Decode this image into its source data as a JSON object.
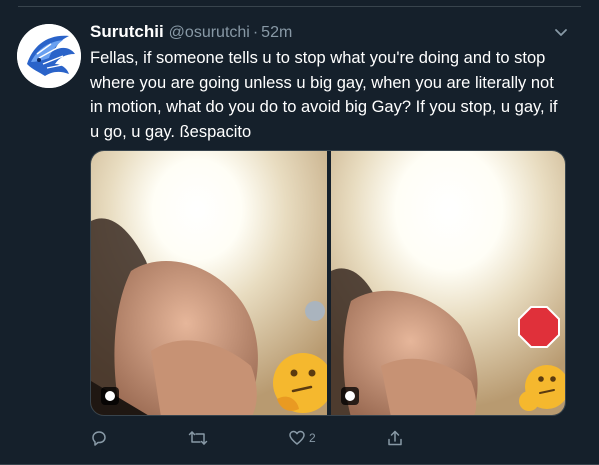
{
  "tweet": {
    "display_name": "Surutchii",
    "handle": "@osurutchi",
    "separator": "·",
    "time": "52m",
    "text": "Fellas, if someone tells u to stop what you're doing and to stop where you are going unless u big gay, when you are literally not in motion, what do you do to avoid big Gay? If you stop, u gay, if u go, u gay. ßespacito",
    "media": [
      {
        "kind": "photo",
        "description_icon": "gif-badge"
      },
      {
        "kind": "photo",
        "description_icon": "gif-badge"
      }
    ],
    "actions": {
      "reply": {
        "icon": "reply-icon",
        "count": ""
      },
      "retweet": {
        "icon": "retweet-icon",
        "count": ""
      },
      "like": {
        "icon": "heart-icon",
        "count": "2"
      },
      "share": {
        "icon": "share-icon",
        "count": ""
      }
    }
  },
  "colors": {
    "background": "#15202b",
    "secondary_text": "#8899a6",
    "divider": "#38444d"
  }
}
